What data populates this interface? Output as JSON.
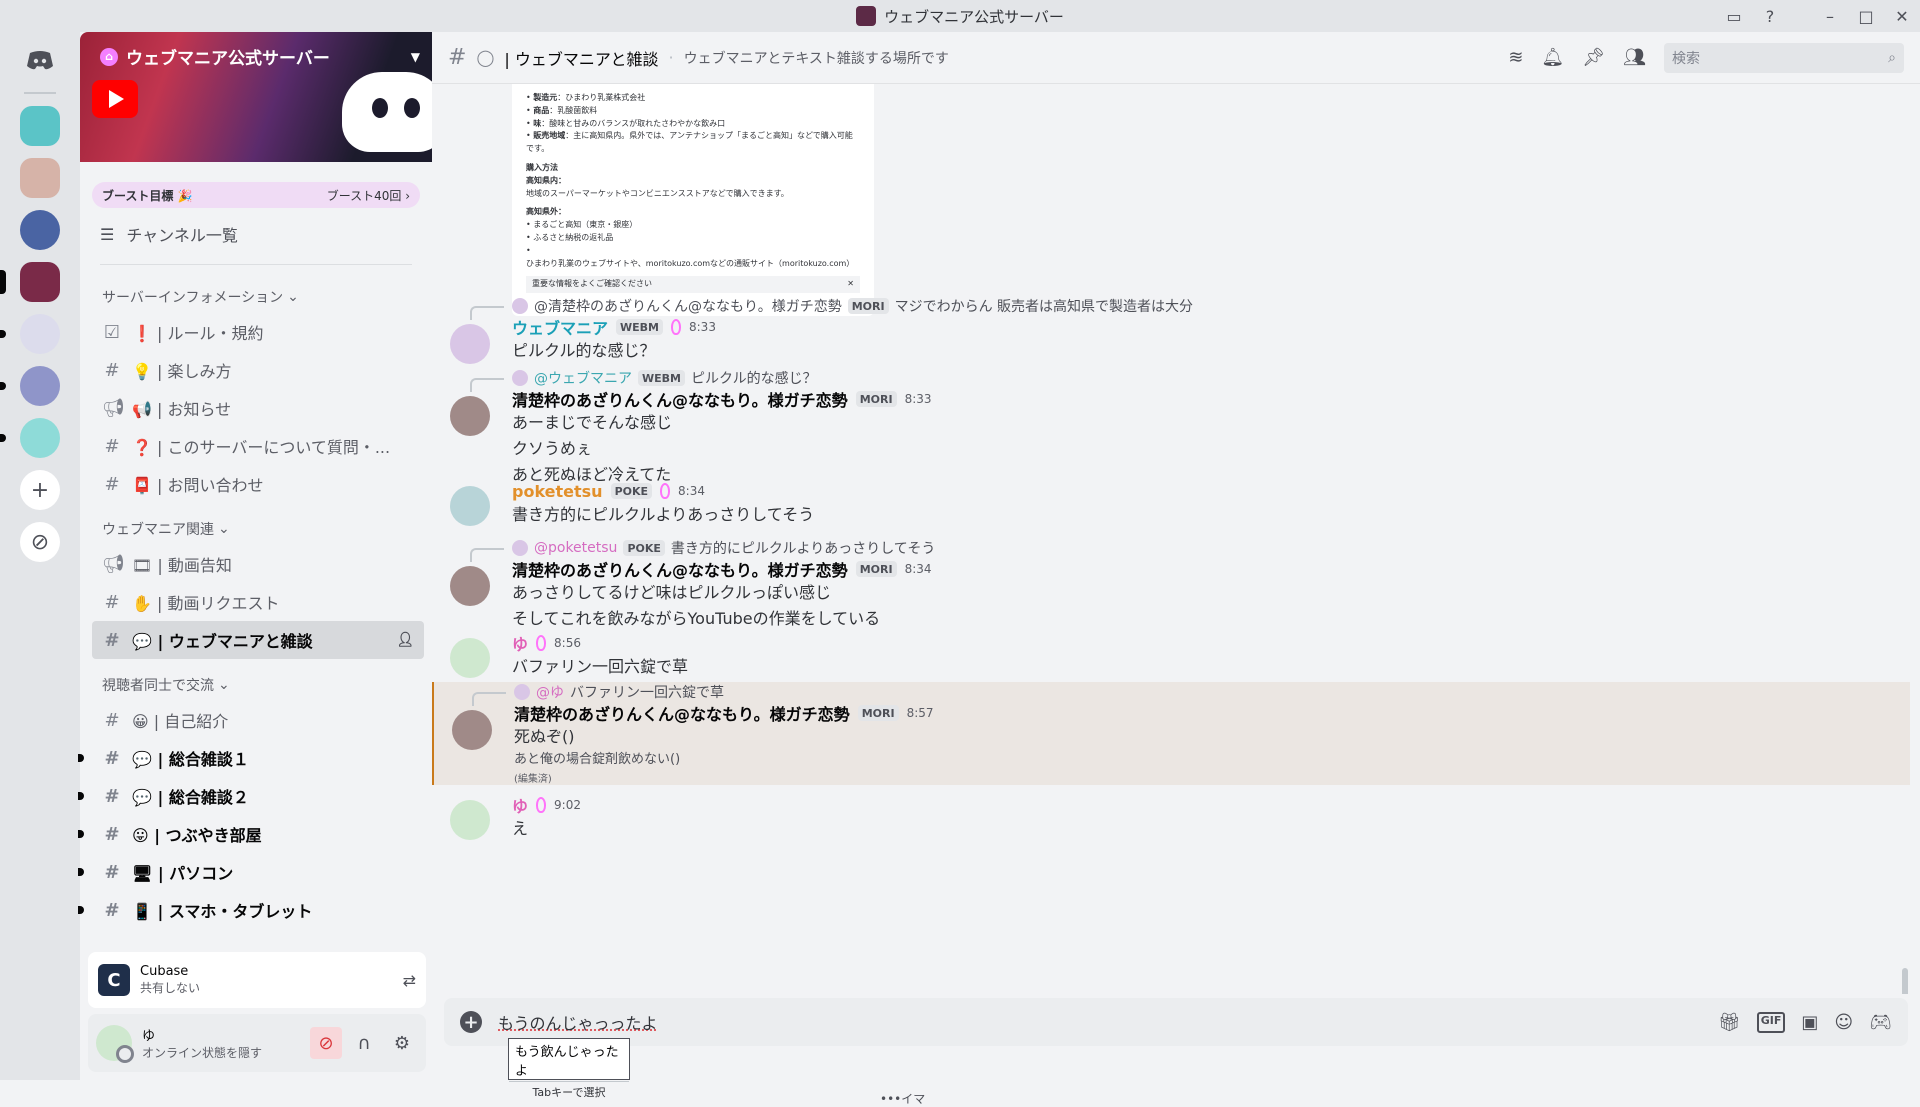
{
  "window": {
    "title": "ウェブマニア公式サーバー"
  },
  "server": {
    "name": "ウェブマニア公式サーバー",
    "boost_goal": "ブースト目標 🎉",
    "boost_progress": "ブースト40回 ›",
    "channel_list_label": "チャンネル一覧"
  },
  "categories": [
    {
      "name": "サーバーインフォメーション",
      "channels": [
        {
          "label": "❗ | ルール・規約",
          "icon": "checklist-icon"
        },
        {
          "label": "💡 | 楽しみ方",
          "icon": "hash-icon"
        },
        {
          "label": "📢 | お知らせ",
          "icon": "announcement-icon"
        },
        {
          "label": "❓ | このサーバーについて質問・...",
          "icon": "hash-icon"
        },
        {
          "label": "📮 | お問い合わせ",
          "icon": "hash-icon"
        }
      ]
    },
    {
      "name": "ウェブマニア関連",
      "channels": [
        {
          "label": "🎞 | 動画告知",
          "icon": "announcement-icon"
        },
        {
          "label": "✋ | 動画リクエスト",
          "icon": "hash-icon"
        },
        {
          "label": "💬 | ウェブマニアと雑談",
          "icon": "hash-icon",
          "active": true
        }
      ]
    },
    {
      "name": "視聴者同士で交流",
      "channels": [
        {
          "label": "😀 | 自己紹介",
          "icon": "hash-icon"
        },
        {
          "label": "💬 | 総合雑談１",
          "icon": "hash-icon",
          "unread": true
        },
        {
          "label": "💬 | 総合雑談２",
          "icon": "hash-icon",
          "unread": true
        },
        {
          "label": "😛 | つぶやき部屋",
          "icon": "hash-icon",
          "unread": true
        },
        {
          "label": "🖥 | パソコン",
          "icon": "hash-icon",
          "unread": true
        },
        {
          "label": "📱 | スマホ・タブレット",
          "icon": "hash-icon",
          "unread": true
        }
      ]
    }
  ],
  "activity": {
    "app": "Cubase",
    "status": "共有しない"
  },
  "user": {
    "name": "ゆ",
    "status": "オンライン状態を隠す"
  },
  "header": {
    "channel": "| ウェブマニアと雑談",
    "topic": "ウェブマニアとテキスト雑談する場所です",
    "search_placeholder": "検索"
  },
  "embed": {
    "lines": [
      [
        "製造元",
        "：ひまわり乳業株式会社"
      ],
      [
        "商品",
        "：乳酸菌飲料"
      ],
      [
        "味",
        "：酸味と甘みのバランスが取れたさわやかな飲み口"
      ],
      [
        "販売地域",
        "：主に高知県内。県外では、アンテナショップ「まるごと高知」などで購入可能です。"
      ]
    ],
    "buy_title": "購入方法",
    "in_pref": "高知県内",
    "in_pref_text": "地域のスーパーマーケットやコンビニエンスストアなどで購入できます。",
    "out_pref": "高知県外",
    "out_items": [
      "まるごと高知（東京・銀座）",
      "ふるさと納税の返礼品",
      "ひまわり乳業のウェブサイトや、moritokuzo.comなどの通販サイト（moritokuzo.com）"
    ],
    "footer": "重要な情報をよくご確認ください"
  },
  "messages": [
    {
      "reply_to": "@清楚枠のあざりんくん@ななもり。様ガチ恋勢",
      "reply_tag": "MORI",
      "reply_text": "マジでわからん 販売者は高知県で製造者は大分",
      "author": "ウェブマニア",
      "tag": "WEBM",
      "time": "8:33",
      "lines": [
        "ピルクル的な感じ？"
      ]
    },
    {
      "reply_to": "@ウェブマニア",
      "reply_tag": "WEBM",
      "reply_text": "ピルクル的な感じ？",
      "author": "清楚枠のあざりんくん@ななもり。様ガチ恋勢",
      "tag": "MORI",
      "time": "8:33",
      "lines": [
        "あーまじでそんな感じ",
        "クソうめぇ",
        "あと死ぬほど冷えてた"
      ]
    },
    {
      "author": "poketetsu",
      "tag": "POKE",
      "time": "8:34",
      "lines": [
        "書き方的にピルクルよりあっさりしてそう"
      ]
    },
    {
      "reply_to": "@poketetsu",
      "reply_tag": "POKE",
      "reply_text": "書き方的にピルクルよりあっさりしてそう",
      "author": "清楚枠のあざりんくん@ななもり。様ガチ恋勢",
      "tag": "MORI",
      "time": "8:34",
      "lines": [
        "あっさりしてるけど味はピルクルっぽい感じ",
        "そしてこれを飲みながらYouTubeの作業をしている"
      ]
    },
    {
      "author": "ゆ",
      "time": "8:56",
      "lines": [
        "バファリン一回六錠で草"
      ]
    },
    {
      "reply_to": "@ゆ",
      "reply_text": "バファリン一回六錠で草",
      "author": "清楚枠のあざりんくん@ななもり。様ガチ恋勢",
      "tag": "MORI",
      "time": "8:57",
      "lines": [
        "死ぬぞ()"
      ],
      "small": "あと俺の場合錠剤飲めない()",
      "edited": "(編集済)"
    },
    {
      "author": "ゆ",
      "time": "9:02",
      "lines": [
        "え"
      ]
    }
  ],
  "composer": {
    "text": "もうのんじゃっったよ",
    "suggestion": "もう飲んじゃったよ",
    "suggestion_hint": "Tabキーで選択",
    "typing": "•••イマ"
  }
}
